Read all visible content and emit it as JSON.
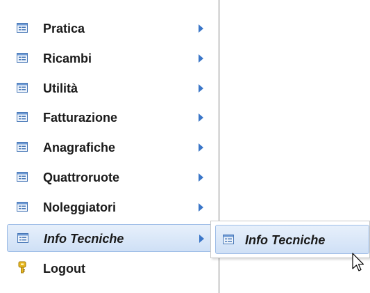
{
  "menu": {
    "items": [
      {
        "label": "Pratica",
        "icon": "list-window-icon",
        "has_submenu": true
      },
      {
        "label": "Ricambi",
        "icon": "list-window-icon",
        "has_submenu": true
      },
      {
        "label": "Utilità",
        "icon": "list-window-icon",
        "has_submenu": true
      },
      {
        "label": "Fatturazione",
        "icon": "list-window-icon",
        "has_submenu": true
      },
      {
        "label": "Anagrafiche",
        "icon": "list-window-icon",
        "has_submenu": true
      },
      {
        "label": "Quattroruote",
        "icon": "list-window-icon",
        "has_submenu": true
      },
      {
        "label": "Noleggiatori",
        "icon": "list-window-icon",
        "has_submenu": true
      },
      {
        "label": "Info Tecniche",
        "icon": "list-window-icon",
        "has_submenu": true,
        "active": true
      },
      {
        "label": "Logout",
        "icon": "key-icon",
        "has_submenu": false
      }
    ]
  },
  "submenu": {
    "items": [
      {
        "label": "Info Tecniche",
        "icon": "list-window-icon"
      }
    ]
  },
  "colors": {
    "arrow": "#3a76c8",
    "highlight_border": "#9dbce6",
    "highlight_top": "#e7f0fb",
    "highlight_bottom": "#cfe0f6",
    "icon_blue": "#4a79b8",
    "key_yellow": "#e8b820"
  }
}
